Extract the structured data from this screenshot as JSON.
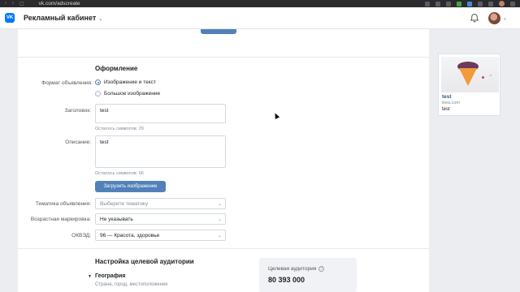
{
  "browser": {
    "url": "vk.com/adscreate"
  },
  "header": {
    "app_title": "Рекламный кабинет",
    "logo": "VK"
  },
  "design": {
    "title": "Оформление",
    "format_label": "Формат объявления:",
    "format_options": [
      "Изображение и текст",
      "Большое изображение"
    ],
    "format_selected": 0,
    "headline_label": "Заголовок:",
    "headline_value": "test",
    "headline_hint": "Осталось символов: 29",
    "description_label": "Описание:",
    "description_value": "test",
    "description_hint": "Осталось символов: 66",
    "upload_button": "Загрузить изображение",
    "topic_label": "Тематика объявления:",
    "topic_placeholder": "Выберите тематику",
    "age_label": "Возрастная маркировка:",
    "age_value": "Не указывать",
    "okved_label": "ОКВЭД:",
    "okved_value": "96 — Красота, здоровье"
  },
  "preview": {
    "title": "test",
    "domain": "ikea.com",
    "description": "test"
  },
  "audience": {
    "title": "Настройка целевой аудитории",
    "geo_title": "География",
    "geo_subtitle": "Страна, город, местоположение",
    "target_label": "Целевая аудитория",
    "target_value": "80 393 000"
  },
  "colors": {
    "accent": "#5181b8",
    "vk_blue": "#0077ff",
    "link": "#2a5885"
  }
}
